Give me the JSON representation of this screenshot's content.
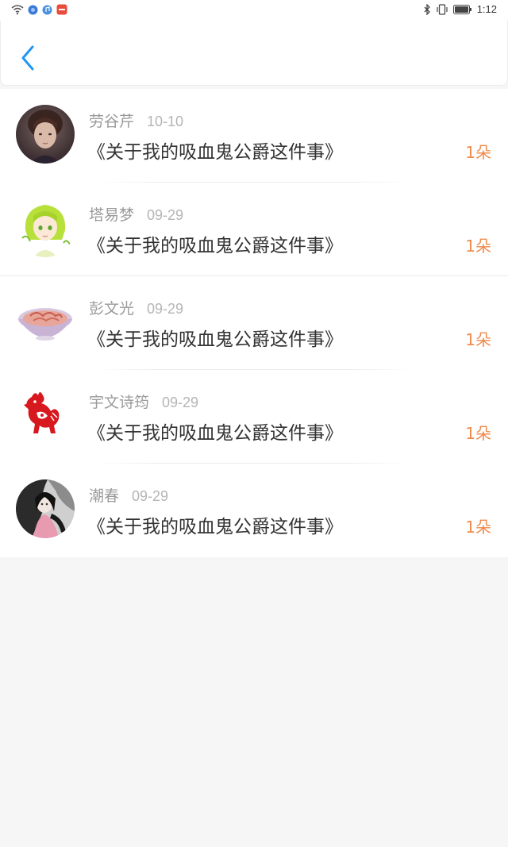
{
  "status_bar": {
    "time": "1:12",
    "icons": [
      "wifi-icon",
      "browser-icon",
      "music-icon",
      "app-notification-icon",
      "bluetooth-icon",
      "vibrate-icon",
      "battery-icon"
    ],
    "colors": {
      "browser": "#3a7bd5",
      "music": "#4a90e2",
      "notification": "#e74c3c"
    }
  },
  "header": {
    "back_icon": "chevron-left-icon",
    "accent_color": "#2196f3"
  },
  "list": {
    "items": [
      {
        "name": "劳谷芹",
        "date": "10-10",
        "title": "《关于我的吸血鬼公爵这件事》",
        "count": "1朵",
        "avatar": "portrait-avatar"
      },
      {
        "name": "塔易梦",
        "date": "09-29",
        "title": "《关于我的吸血鬼公爵这件事》",
        "count": "1朵",
        "avatar": "anime-girl-avatar"
      },
      {
        "name": "彭文光",
        "date": "09-29",
        "title": "《关于我的吸血鬼公爵这件事》",
        "count": "1朵",
        "avatar": "bowl-avatar"
      },
      {
        "name": "宇文诗筠",
        "date": "09-29",
        "title": "《关于我的吸血鬼公爵这件事》",
        "count": "1朵",
        "avatar": "paper-cut-rooster-avatar"
      },
      {
        "name": "潮春",
        "date": "09-29",
        "title": "《关于我的吸血鬼公爵这件事》",
        "count": "1朵",
        "avatar": "illustration-avatar"
      }
    ]
  },
  "colors": {
    "count": "#f08a4b",
    "name": "#9b9b9b",
    "date": "#b5b5b5",
    "title": "#333333",
    "background": "#f7f6f7"
  }
}
